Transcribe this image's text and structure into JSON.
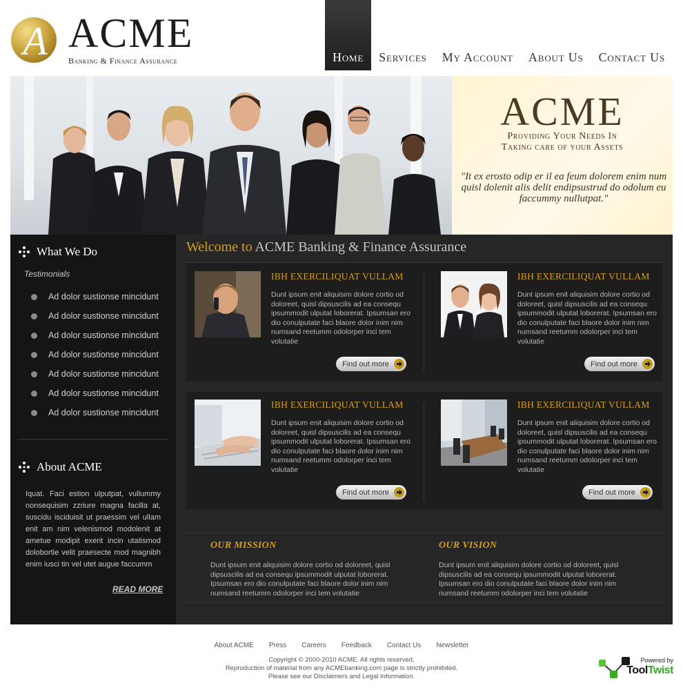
{
  "logo": {
    "name": "ACME",
    "tagline": "Banking & Finance Assurance",
    "monogram": "A"
  },
  "nav": {
    "items": [
      {
        "label": "Home",
        "active": true
      },
      {
        "label": "Services",
        "active": false
      },
      {
        "label": "My Account",
        "active": false
      },
      {
        "label": "About Us",
        "active": false
      },
      {
        "label": "Contact Us",
        "active": false
      }
    ]
  },
  "banner": {
    "title": "ACME",
    "subtitle_line1": "Providing Your Needs In",
    "subtitle_line2": "Taking care of your Assets",
    "quote": "\"It ex erosto odip er il ea feum dolorem enim num quisl dolenit alis delit endipsustrud do odolum eu faccummy nullutpat.\""
  },
  "sidebar": {
    "what_we_do": "What We Do",
    "testimonials": "Testimonials",
    "items": [
      "Ad dolor sustionse mincidunt",
      "Ad dolor sustionse mincidunt",
      "Ad dolor sustionse mincidunt",
      "Ad dolor sustionse mincidunt",
      "Ad dolor sustionse mincidunt",
      "Ad dolor sustionse mincidunt",
      "Ad dolor sustionse mincidunt"
    ],
    "about_title": "About ACME",
    "about_text": "Iquat. Faci estion ulputpat, vullummy nonsequisim zzriure magna facilla at, suscidu isciduisit ut praessim vel ullam enit am nim velenismod modolenit at ametue modipit exerit incin utatismod dolobortie velit praesecte mod magnibh enim iusci tin vel utet augue faccumm",
    "read_more": "READ MORE"
  },
  "welcome": {
    "prefix": "Welcome to",
    "name": "ACME Banking & Finance Assurance"
  },
  "cards": [
    {
      "title": "IBH EXERCILIQUAT VULLAM",
      "text": "Dunt ipsum enit aliquisim dolore cortio od doloreet, quisl dipsuscilis ad ea consequ ipsummodit ulputat loborerat. Ipsumsan ero dio conulputate faci blaore dolor inim nim numsand reetumm odolorper inci tem volutatie",
      "button": "Find out more"
    },
    {
      "title": "IBH EXERCILIQUAT VULLAM",
      "text": "Dunt ipsum enit aliquisim dolore cortio od doloreet, quisl dipsuscilis ad ea consequ ipsummodit ulputat loborerat. Ipsumsan ero dio conulputate faci blaore dolor inim nim numsand reetumm odolorper inci tem volutatie",
      "button": "Find out more"
    },
    {
      "title": "IBH EXERCILIQUAT VULLAM",
      "text": "Dunt ipsum enit aliquisim dolore cortio od doloreet, quisl dipsuscilis ad ea consequ ipsummodit ulputat loborerat. Ipsumsan ero dio conulputate faci blaore dolor inim nim numsand reetumm odolorper inci tem volutatie",
      "button": "Find out more"
    },
    {
      "title": "IBH EXERCILIQUAT VULLAM",
      "text": "Dunt ipsum enit aliquisim dolore cortio od doloreet, quisl dipsuscilis ad ea consequ ipsummodit ulputat loborerat. Ipsumsan ero dio conulputate faci blaore dolor inim nim numsand reetumm odolorper inci tem volutatie",
      "button": "Find out more"
    }
  ],
  "mission": {
    "title": "OUR MISSION",
    "text": "Dunt ipsum enit aliquisim dolore cortio od doloreet, quisl dipsuscilis ad ea consequ ipsummodit ulputat loborerat. Ipsumsan ero dio conulputate faci blaore dolor inim nim numsand reetumm odolorper inci tem volutatie"
  },
  "vision": {
    "title": "OUR VISION",
    "text": "Dunt ipsum enit aliquisim dolore cortio od doloreet, quisl dipsuscilis ad ea consequ ipsummodit ulputat loborerat. Ipsumsan ero dio conulputate faci blaore dolor inim nim numsand reetumm odolorper inci tem volutatie"
  },
  "footer": {
    "links": [
      "About ACME",
      "Press",
      "Careers",
      "Feedback",
      "Contact Us",
      "Newsletter"
    ],
    "copyright": "Copyright © 2000-2010 ACME. All rights reserved.",
    "reproduction": "Reproduction of material from any ACMEbanking.com page is strictly prohibited.",
    "disclaimer": "Please see our Disclaimers and Legal Information.",
    "powered_by": "Powered by",
    "powered_name_1": "Tool",
    "powered_name_2": "Twist"
  },
  "colors": {
    "accent_gold": "#d69e14",
    "dark_bg": "#262626",
    "sidebar_bg": "#151515",
    "banner_cream": "#fff4d2"
  }
}
